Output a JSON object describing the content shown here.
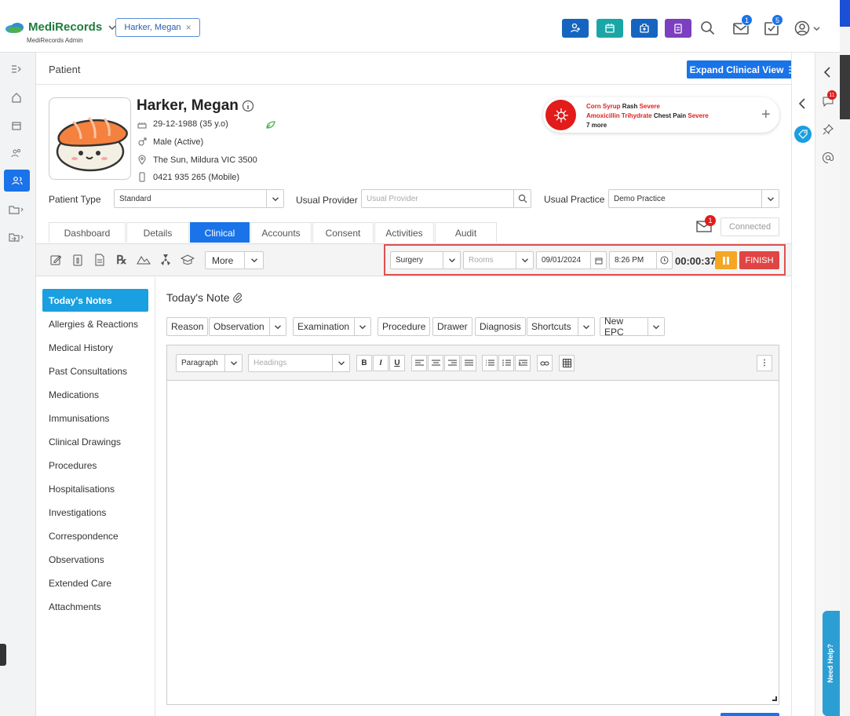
{
  "app": {
    "brand": "MediRecords",
    "subtitle": "MediRecords Admin"
  },
  "header": {
    "open_tab": "Harker, Megan",
    "mail_count": "1",
    "tasks_count": "5"
  },
  "page": {
    "title": "Patient",
    "expand_button": "Expand Clinical View"
  },
  "patient": {
    "name": "Harker, Megan",
    "dob": "29-12-1988 (35 y.o)",
    "gender": "Male (Active)",
    "address": "The Sun, Mildura VIC 3500",
    "phone": "0421 935 265 (Mobile)"
  },
  "allergies": [
    {
      "substance": "Corn Syrup",
      "reaction": "Rash",
      "severity": "Severe"
    },
    {
      "substance": "Amoxicillin Trihydrate",
      "reaction": "Chest Pain",
      "severity": "Severe"
    }
  ],
  "allergies_more": "7 more",
  "fields": {
    "patient_type_label": "Patient Type",
    "patient_type_value": "Standard",
    "usual_provider_label": "Usual Provider",
    "usual_provider_placeholder": "Usual Provider",
    "usual_practice_label": "Usual Practice",
    "usual_practice_value": "Demo Practice"
  },
  "tabs": [
    "Dashboard",
    "Details",
    "Clinical",
    "Accounts",
    "Consent",
    "Activities",
    "Audit"
  ],
  "active_tab": "Clinical",
  "messages_count": "1",
  "connected_label": "Connected",
  "toolbar": {
    "more_label": "More",
    "rx_label": "℞"
  },
  "consult": {
    "location": "Surgery",
    "rooms_placeholder": "Rooms",
    "date": "09/01/2024",
    "time": "8:26 PM",
    "timer": "00:00:37",
    "finish_label": "FINISH"
  },
  "sidebar": [
    "Today's Notes",
    "Allergies & Reactions",
    "Medical History",
    "Past Consultations",
    "Medications",
    "Immunisations",
    "Clinical Drawings",
    "Procedures",
    "Hospitalisations",
    "Investigations",
    "Correspondence",
    "Observations",
    "Extended Care",
    "Attachments"
  ],
  "note": {
    "title": "Today's Note",
    "buttons": [
      "Reason",
      "Observation",
      "Examination",
      "Procedure",
      "Drawer",
      "Diagnosis",
      "Shortcuts",
      "New EPC"
    ],
    "paragraph_label": "Paragraph",
    "headings_placeholder": "Headings"
  },
  "right_panel": {
    "notifications_count": "11"
  },
  "help_label": "Need Help?",
  "colors": {
    "primary": "#1a73e8",
    "severe": "#e02020",
    "finish": "#e04444",
    "pause": "#f5a623",
    "highlight": "#e05050"
  }
}
